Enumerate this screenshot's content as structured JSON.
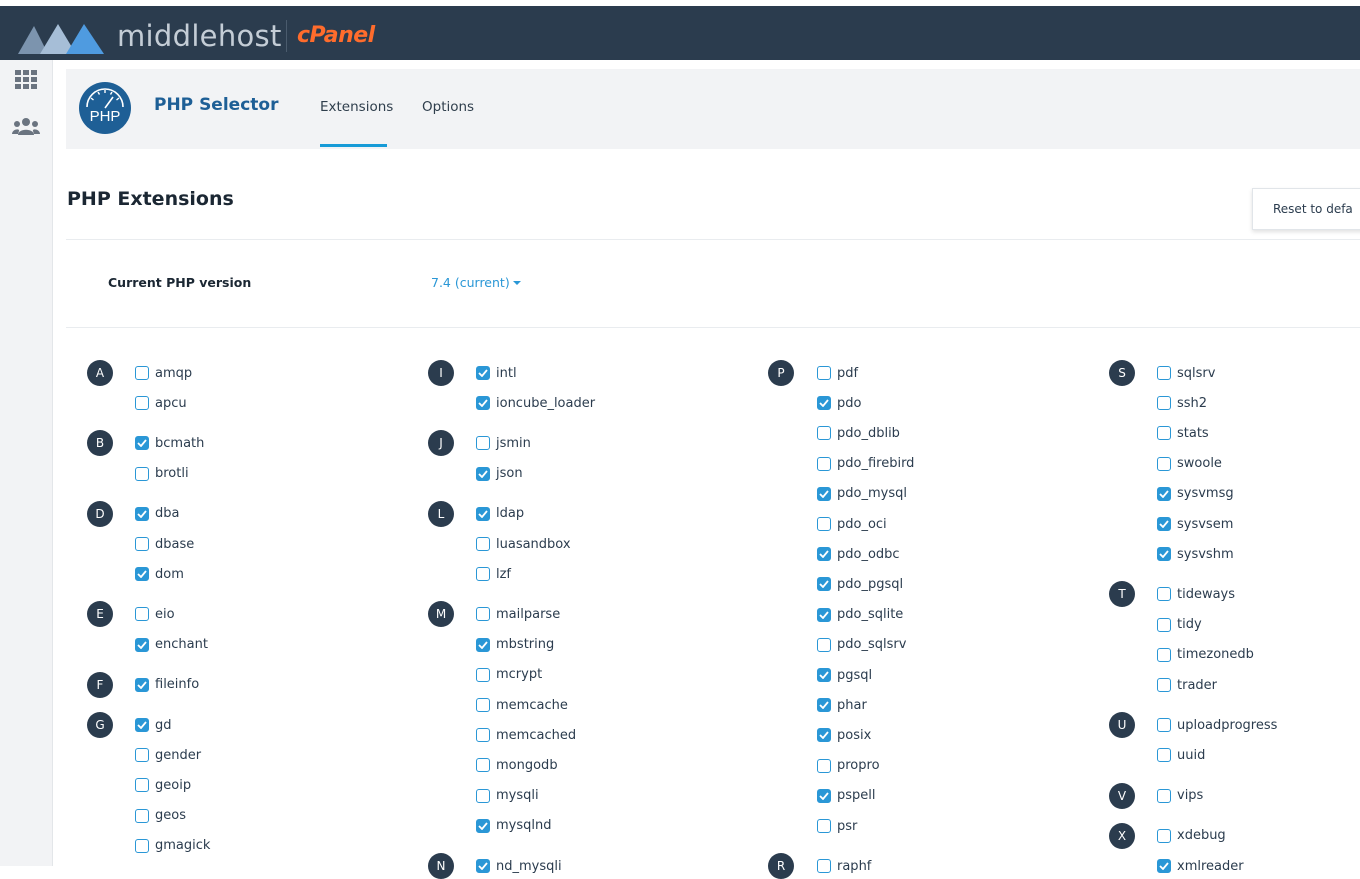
{
  "brand": {
    "name": "middlehost",
    "product": "cPanel"
  },
  "header": {
    "title": "PHP Selector",
    "icon_text": "PHP",
    "tabs": [
      {
        "label": "Extensions",
        "active": true
      },
      {
        "label": "Options",
        "active": false
      }
    ]
  },
  "section": {
    "title": "PHP Extensions",
    "reset_label": "Reset to defa",
    "version_label": "Current PHP version",
    "version_value": "7.4 (current)"
  },
  "colors": {
    "topbar": "#2b3c4e",
    "accent": "#2a97d6",
    "cpanel": "#ff6c2c"
  },
  "columns": [
    {
      "groups": [
        {
          "letter": "A",
          "items": [
            {
              "name": "amqp",
              "checked": false
            },
            {
              "name": "apcu",
              "checked": false
            }
          ]
        },
        {
          "letter": "B",
          "items": [
            {
              "name": "bcmath",
              "checked": true
            },
            {
              "name": "brotli",
              "checked": false
            }
          ]
        },
        {
          "letter": "D",
          "items": [
            {
              "name": "dba",
              "checked": true
            },
            {
              "name": "dbase",
              "checked": false
            },
            {
              "name": "dom",
              "checked": true
            }
          ]
        },
        {
          "letter": "E",
          "items": [
            {
              "name": "eio",
              "checked": false
            },
            {
              "name": "enchant",
              "checked": true
            }
          ]
        },
        {
          "letter": "F",
          "items": [
            {
              "name": "fileinfo",
              "checked": true
            }
          ]
        },
        {
          "letter": "G",
          "items": [
            {
              "name": "gd",
              "checked": true
            },
            {
              "name": "gender",
              "checked": false
            },
            {
              "name": "geoip",
              "checked": false
            },
            {
              "name": "geos",
              "checked": false
            },
            {
              "name": "gmagick",
              "checked": false
            }
          ]
        }
      ]
    },
    {
      "groups": [
        {
          "letter": "I",
          "items": [
            {
              "name": "intl",
              "checked": true
            },
            {
              "name": "ioncube_loader",
              "checked": true
            }
          ]
        },
        {
          "letter": "J",
          "items": [
            {
              "name": "jsmin",
              "checked": false
            },
            {
              "name": "json",
              "checked": true
            }
          ]
        },
        {
          "letter": "L",
          "items": [
            {
              "name": "ldap",
              "checked": true
            },
            {
              "name": "luasandbox",
              "checked": false
            },
            {
              "name": "lzf",
              "checked": false
            }
          ]
        },
        {
          "letter": "M",
          "items": [
            {
              "name": "mailparse",
              "checked": false
            },
            {
              "name": "mbstring",
              "checked": true
            },
            {
              "name": "mcrypt",
              "checked": false
            },
            {
              "name": "memcache",
              "checked": false
            },
            {
              "name": "memcached",
              "checked": false
            },
            {
              "name": "mongodb",
              "checked": false
            },
            {
              "name": "mysqli",
              "checked": false
            },
            {
              "name": "mysqlnd",
              "checked": true
            }
          ]
        },
        {
          "letter": "N",
          "items": [
            {
              "name": "nd_mysqli",
              "checked": true
            }
          ]
        }
      ]
    },
    {
      "groups": [
        {
          "letter": "P",
          "items": [
            {
              "name": "pdf",
              "checked": false
            },
            {
              "name": "pdo",
              "checked": true
            },
            {
              "name": "pdo_dblib",
              "checked": false
            },
            {
              "name": "pdo_firebird",
              "checked": false
            },
            {
              "name": "pdo_mysql",
              "checked": true
            },
            {
              "name": "pdo_oci",
              "checked": false
            },
            {
              "name": "pdo_odbc",
              "checked": true
            },
            {
              "name": "pdo_pgsql",
              "checked": true
            },
            {
              "name": "pdo_sqlite",
              "checked": true
            },
            {
              "name": "pdo_sqlsrv",
              "checked": false
            },
            {
              "name": "pgsql",
              "checked": true
            },
            {
              "name": "phar",
              "checked": true
            },
            {
              "name": "posix",
              "checked": true
            },
            {
              "name": "propro",
              "checked": false
            },
            {
              "name": "pspell",
              "checked": true
            },
            {
              "name": "psr",
              "checked": false
            }
          ]
        },
        {
          "letter": "R",
          "items": [
            {
              "name": "raphf",
              "checked": false
            }
          ]
        }
      ]
    },
    {
      "groups": [
        {
          "letter": "S",
          "items": [
            {
              "name": "sqlsrv",
              "checked": false
            },
            {
              "name": "ssh2",
              "checked": false
            },
            {
              "name": "stats",
              "checked": false
            },
            {
              "name": "swoole",
              "checked": false
            },
            {
              "name": "sysvmsg",
              "checked": true
            },
            {
              "name": "sysvsem",
              "checked": true
            },
            {
              "name": "sysvshm",
              "checked": true
            }
          ]
        },
        {
          "letter": "T",
          "items": [
            {
              "name": "tideways",
              "checked": false
            },
            {
              "name": "tidy",
              "checked": false
            },
            {
              "name": "timezonedb",
              "checked": false
            },
            {
              "name": "trader",
              "checked": false
            }
          ]
        },
        {
          "letter": "U",
          "items": [
            {
              "name": "uploadprogress",
              "checked": false
            },
            {
              "name": "uuid",
              "checked": false
            }
          ]
        },
        {
          "letter": "V",
          "items": [
            {
              "name": "vips",
              "checked": false
            }
          ]
        },
        {
          "letter": "X",
          "items": [
            {
              "name": "xdebug",
              "checked": false
            },
            {
              "name": "xmlreader",
              "checked": true
            }
          ]
        }
      ]
    }
  ]
}
